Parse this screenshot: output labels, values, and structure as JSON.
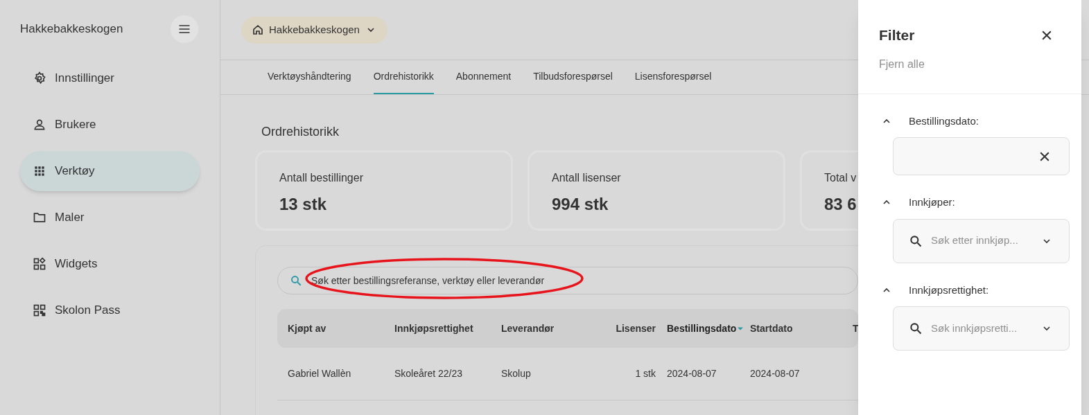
{
  "sidebar": {
    "title": "Hakkebakkeskogen",
    "items": [
      {
        "label": "Innstillinger",
        "selected": false
      },
      {
        "label": "Brukere",
        "selected": false
      },
      {
        "label": "Verktøy",
        "selected": true
      },
      {
        "label": "Maler",
        "selected": false
      },
      {
        "label": "Widgets",
        "selected": false
      },
      {
        "label": "Skolon Pass",
        "selected": false
      }
    ]
  },
  "location_chip": {
    "label": "Hakkebakkeskogen"
  },
  "tabs": [
    {
      "label": "Verktøyshåndtering",
      "selected": false
    },
    {
      "label": "Ordrehistorikk",
      "selected": true
    },
    {
      "label": "Abonnement",
      "selected": false
    },
    {
      "label": "Tilbudsforespørsel",
      "selected": false
    },
    {
      "label": "Lisensforespørsel",
      "selected": false
    }
  ],
  "page_title": "Ordrehistorikk",
  "stats": [
    {
      "label": "Antall bestillinger",
      "value": "13 stk"
    },
    {
      "label": "Antall lisenser",
      "value": "994 stk"
    },
    {
      "label": "Total v",
      "value": "83 6"
    }
  ],
  "search": {
    "placeholder": "Søk etter bestillingsreferanse, verktøy eller leverandør"
  },
  "highlight": {
    "kind": "ellipse",
    "color": "#e8141c"
  },
  "table": {
    "columns": [
      {
        "label": "Kjøpt av",
        "sorted": false
      },
      {
        "label": "Innkjøpsrettighet",
        "sorted": false
      },
      {
        "label": "Leverandør",
        "sorted": false
      },
      {
        "label": "Lisenser",
        "sorted": false
      },
      {
        "label": "Bestillingsdato",
        "sorted": true
      },
      {
        "label": "Startdato",
        "sorted": false
      },
      {
        "label": "T",
        "sorted": false
      }
    ],
    "rows": [
      [
        "Gabriel Wallèn",
        "Skoleåret 22/23",
        "Skolup",
        "1 stk",
        "2024-08-07",
        "2024-08-07"
      ]
    ]
  },
  "filter_panel": {
    "title": "Filter",
    "clear_all": "Fjern alle",
    "sections": [
      {
        "label": "Bestillingsdato:",
        "kind": "date",
        "expanded": true
      },
      {
        "label": "Innkjøper:",
        "kind": "search",
        "expanded": true,
        "placeholder": "Søk etter innkjøp..."
      },
      {
        "label": "Innkjøpsrettighet:",
        "kind": "search",
        "expanded": true,
        "placeholder": "Søk innkjøpsretti..."
      }
    ]
  }
}
